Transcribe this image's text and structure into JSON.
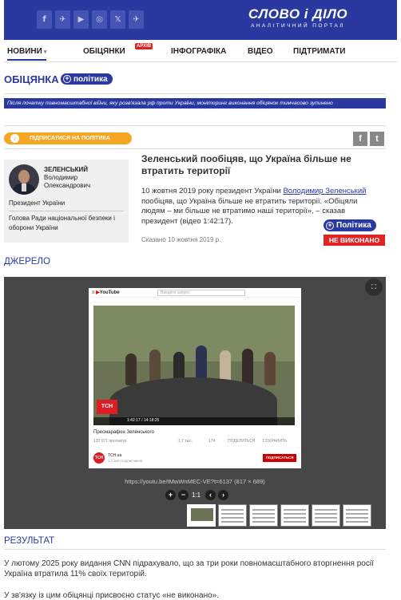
{
  "header": {
    "socials": [
      "f",
      "✈",
      "▶",
      "◎",
      "𝕏",
      "✈"
    ],
    "logo": "СЛОВО і ДІЛО",
    "logo_sub": "АНАЛІТИЧНИЙ ПОРТАЛ"
  },
  "nav": {
    "items": [
      "НОВИНИ",
      "ОБІЦЯНКИ",
      "ІНФОГРАФІКА",
      "ВІДЕО",
      "ПІДТРИМАТИ"
    ],
    "badge": "АРХІВ"
  },
  "page": {
    "title": "ОБІЦЯНКА",
    "tag": "політика",
    "notice": "Після початку повномасштабної війни, яку розв'язала рф проти України, моніторинг виконання обіцянок тимчасово зупинено",
    "subscribe": "ПІДПИСАТИСЯ НА ПОЛІТИКА"
  },
  "person": {
    "surname": "ЗЕЛЕНСЬКИЙ",
    "name": "Володимир",
    "patronymic": "Олександрович",
    "role1": "Президент України",
    "role2": "Голова Ради національної безпеки і оборони України"
  },
  "promise": {
    "title": "Зеленський пообіцяв, що Україна більше не втратить території",
    "body_pre": "10 жовтня 2019 року президент України ",
    "body_link": "Володимир Зеленський",
    "body_post": " пообіцяв, що Україна більше не втратить території. «Обіцяли людям – ми більше не втратимо наші території», – сказав президент (відео 1:42:17).",
    "tag": "Політика",
    "said": "Сказано 10 жовтня 2019 р.",
    "status": "НЕ ВИКОНАНО"
  },
  "source": {
    "heading": "ДЖЕРЕЛО",
    "yt_logo": "YouTube",
    "yt_search": "Введите запрос",
    "video_title": "Пресмарафон Зеленського",
    "views": "120 071 просмотр",
    "likes": "1,7 тыс.",
    "dislikes": "174",
    "share": "ПОДЕЛИТЬСЯ",
    "save": "СОХРАНИТЬ",
    "time": "1:42:17 / 14:18:25",
    "channel": "ТСН",
    "channel_name": "ТСН.ua",
    "channel_subs": "1,2 млн подписчиков",
    "yt_subscribe": "ПОДПИСАТЬСЯ",
    "tsn": "ТСН",
    "caption": "https://youtu.be/tMwWnMEC-VE?t=6137 (817 × 689)",
    "zoom": "1:1"
  },
  "result": {
    "heading": "РЕЗУЛЬТАТ",
    "p1": "У лютому 2025 року видання CNN підрахувало, що за три роки повномасштабного вторгнення росії Україна втратила 11% своїх територій.",
    "p2": "У зв'язку із цим обіцянці присвоєно статус «не виконано»."
  }
}
